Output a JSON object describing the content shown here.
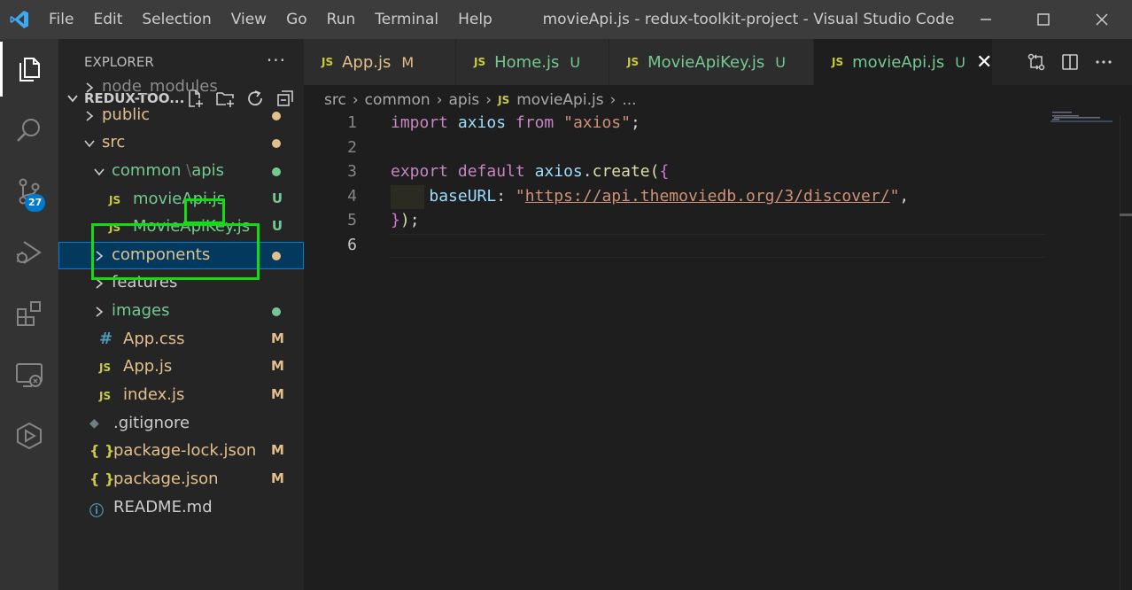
{
  "titlebar": {
    "menu": [
      "File",
      "Edit",
      "Selection",
      "View",
      "Go",
      "Run",
      "Terminal",
      "Help"
    ],
    "window_title": "movieApi.js - redux-toolkit-project - Visual Studio Code"
  },
  "activity_bar": {
    "items": [
      "explorer",
      "search",
      "source-control",
      "run-and-debug",
      "extensions",
      "remote-explorer",
      "testing"
    ],
    "source_control_badge": "27"
  },
  "explorer": {
    "header": "EXPLORER",
    "more": "···",
    "project_name": "REDUX-TOO...",
    "tree": [
      {
        "label": "node_modules",
        "type": "folder",
        "status": "",
        "color": "#8c8c8c"
      },
      {
        "label": "public",
        "type": "folder",
        "status": "dot",
        "color": "#e2c08d"
      },
      {
        "label": "src",
        "type": "folder",
        "status": "dot",
        "color": "#e2c08d"
      },
      {
        "label": "common",
        "label2": "apis",
        "type": "folder",
        "status": "dot",
        "color": "#73c991"
      },
      {
        "label": "movieApi.js",
        "type": "js",
        "status": "U",
        "color": "#73c991"
      },
      {
        "label": "MovieApiKey.js",
        "type": "js",
        "status": "U",
        "color": "#73c991"
      },
      {
        "label": "components",
        "type": "folder",
        "status": "dot",
        "color": "#e2c08d"
      },
      {
        "label": "features",
        "type": "folder",
        "status": "",
        "color": "#cccccc"
      },
      {
        "label": "images",
        "type": "folder",
        "status": "dot",
        "color": "#73c991"
      },
      {
        "label": "App.css",
        "type": "css",
        "status": "M",
        "color": "#e2c08d"
      },
      {
        "label": "App.js",
        "type": "js",
        "status": "M",
        "color": "#e2c08d"
      },
      {
        "label": "index.js",
        "type": "js",
        "status": "M",
        "color": "#e2c08d"
      },
      {
        "label": ".gitignore",
        "type": "git",
        "status": "",
        "color": "#cccccc"
      },
      {
        "label": "package-lock.json",
        "type": "json",
        "status": "M",
        "color": "#e2c08d"
      },
      {
        "label": "package.json",
        "type": "json",
        "status": "M",
        "color": "#e2c08d"
      },
      {
        "label": "README.md",
        "type": "info",
        "status": "",
        "color": "#cccccc"
      }
    ]
  },
  "tabs": [
    {
      "icon": "JS",
      "label": "App.js",
      "status": "M",
      "color": "#e2c08d"
    },
    {
      "icon": "JS",
      "label": "Home.js",
      "status": "U",
      "color": "#73c991"
    },
    {
      "icon": "JS",
      "label": "MovieApiKey.js",
      "status": "U",
      "color": "#73c991"
    },
    {
      "icon": "JS",
      "label": "movieApi.js",
      "status": "U",
      "color": "#73c991",
      "close": "✕"
    }
  ],
  "breadcrumb": {
    "parts": [
      "src",
      "common",
      "apis"
    ],
    "file_icon": "JS",
    "file": "movieApi.js",
    "tail": "..."
  },
  "code": {
    "line_numbers": [
      "1",
      "2",
      "3",
      "4",
      "5",
      "6"
    ],
    "l1": {
      "kw1": "import",
      "var": "axios",
      "kw2": "from",
      "str": "\"axios\"",
      "punct": ";"
    },
    "l3": {
      "kw1": "export",
      "kw2": "default",
      "var": "axios",
      "dot": ".",
      "fn": "create",
      "paren": "(",
      "brace": "{"
    },
    "l4": {
      "prop": "baseURL",
      "colon": ":",
      "q1": "\"",
      "url": "https://api.themoviedb.org/3/discover/",
      "q2": "\"",
      "comma": ","
    },
    "l5": {
      "brace": "}",
      "paren": ")",
      "semi": ";"
    }
  }
}
